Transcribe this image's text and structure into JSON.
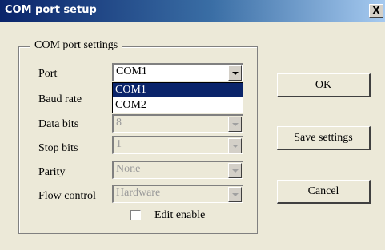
{
  "window": {
    "title": "COM port setup",
    "close_label": "X"
  },
  "group": {
    "legend": "COM port settings"
  },
  "fields": {
    "port": {
      "label": "Port",
      "value": "COM1"
    },
    "baud_rate": {
      "label": "Baud rate",
      "value": ""
    },
    "data_bits": {
      "label": "Data bits",
      "value": "8"
    },
    "stop_bits": {
      "label": "Stop bits",
      "value": "1"
    },
    "parity": {
      "label": "Parity",
      "value": "None"
    },
    "flow_control": {
      "label": "Flow control",
      "value": "Hardware"
    }
  },
  "port_dropdown": {
    "options": [
      "COM1",
      "COM2"
    ],
    "selected": "COM1"
  },
  "buttons": {
    "ok": "OK",
    "save": "Save settings",
    "cancel": "Cancel"
  },
  "edit_enable": {
    "label": "Edit enable",
    "checked": false
  }
}
